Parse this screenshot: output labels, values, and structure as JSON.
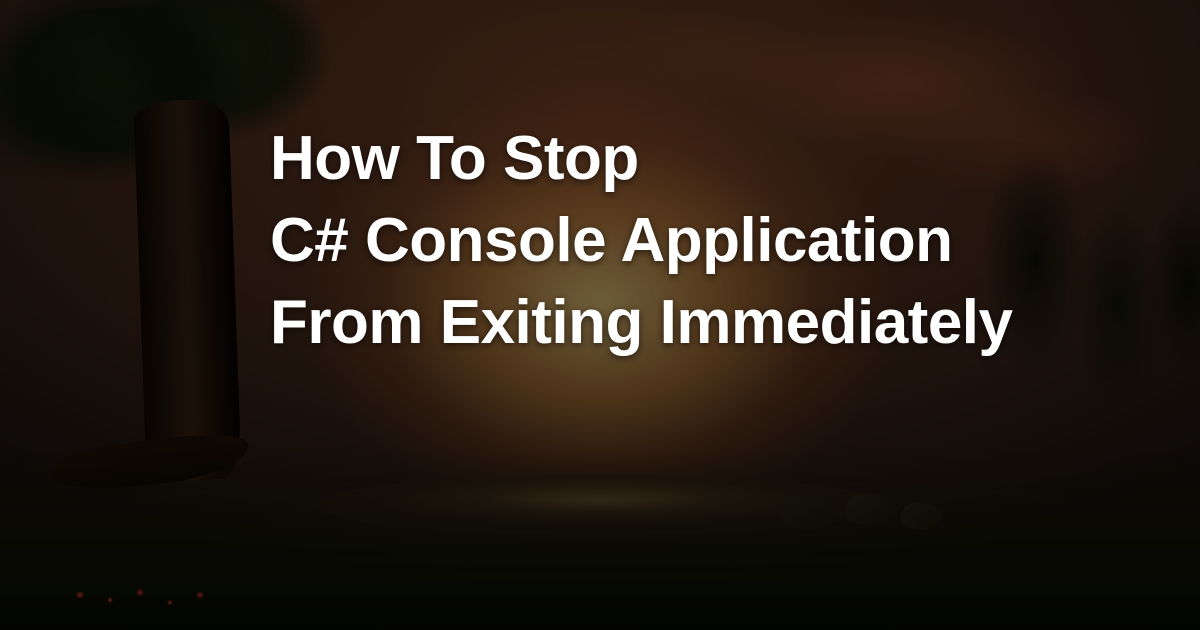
{
  "title": "How To Stop\nC# Console Application\nFrom Exiting Immediately"
}
